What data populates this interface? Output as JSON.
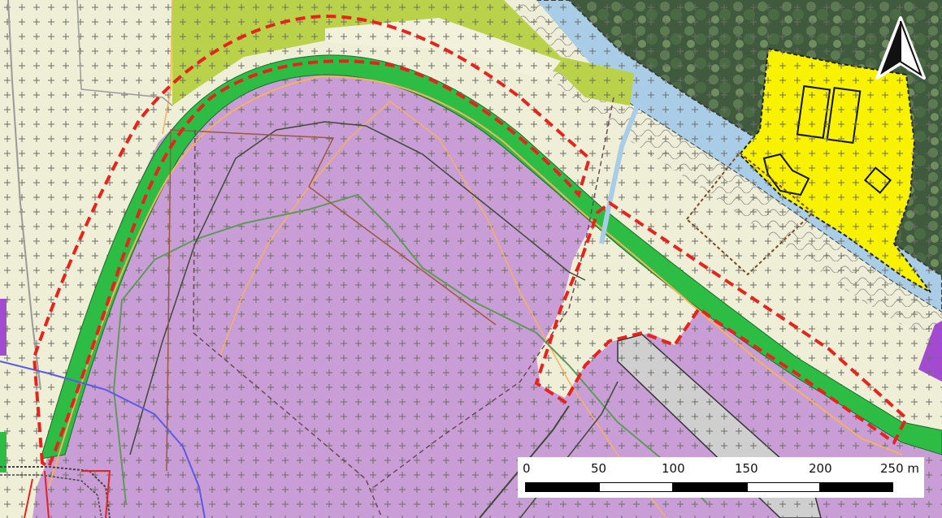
{
  "map": {
    "colors": {
      "background_zone": "#efeed6",
      "cross_hatch": "#7a7a70",
      "purple_zone": "#c99dd6",
      "green_strip": "#2dbd45",
      "lime_zone": "#b9d24a",
      "yellow_zone": "#f8f200",
      "boundary_red": "#e8221c",
      "river_blue": "#a9cde6",
      "forest": "#4f6a48",
      "road_grey": "#cfcfcf",
      "line_orange": "#f6b25c",
      "line_green": "#5e9a58",
      "line_dark": "#3f4a38",
      "line_brown": "#9a5a3a",
      "line_blue": "#5a5ae6"
    },
    "north_arrow": {
      "icon": "north-arrow-icon"
    },
    "scale_bar": {
      "ticks": [
        "0",
        "50",
        "100",
        "150",
        "200",
        "250 m"
      ]
    }
  }
}
